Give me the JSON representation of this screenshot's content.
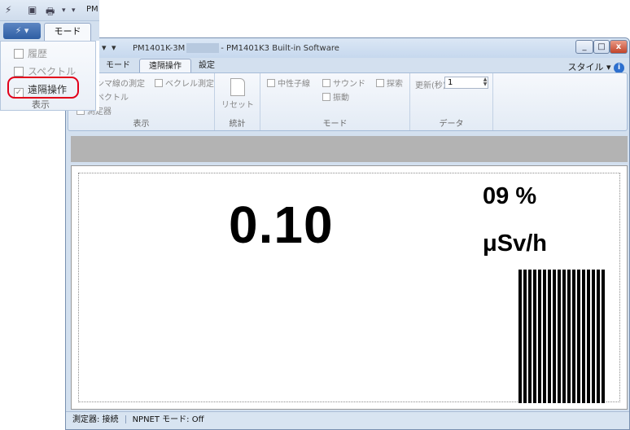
{
  "front_window": {
    "qat_pm_text": "PM",
    "tab_mode": "モード",
    "items": [
      {
        "label": "履歴",
        "checked": false
      },
      {
        "label": "スペクトル",
        "checked": false
      },
      {
        "label": "遠隔操作",
        "checked": true
      }
    ],
    "group_label": "表示"
  },
  "main_window": {
    "title_left": "PM1401K-3M",
    "title_right": "- PM1401K3 Built-in Software",
    "window_controls": {
      "minimize": "_",
      "maximize": "□",
      "close": "x"
    },
    "tabs": [
      {
        "label": "モード",
        "active": false
      },
      {
        "label": "遠隔操作",
        "active": true
      },
      {
        "label": "設定",
        "active": false
      }
    ],
    "style_menu": "スタイル",
    "ribbon": {
      "display_group": {
        "items": [
          "ンマ線の測定",
          "ペクトル",
          "測定器"
        ],
        "becquerel": "ベクレル測定",
        "label": "表示"
      },
      "stats_group": {
        "reset_label": "リセット",
        "label": "統計"
      },
      "mode_group": {
        "neutron": "中性子線",
        "sound": "サウンド",
        "vibration": "振動",
        "search": "探索",
        "label": "モード"
      },
      "data_group": {
        "update_label": "更新(秒)",
        "update_value": "1",
        "label": "データ"
      }
    },
    "display": {
      "dose_rate": "0.10",
      "percent": "09 %",
      "unit": "μSv/h",
      "level_fraction": 0.58
    },
    "status": {
      "device": "測定器: 接続",
      "npnet": "NPNET モード: Off"
    }
  },
  "colors": {
    "accent_blue": "#2e5ea3",
    "highlight_red": "#e2001a",
    "status_bar": "#d8e4f1"
  }
}
